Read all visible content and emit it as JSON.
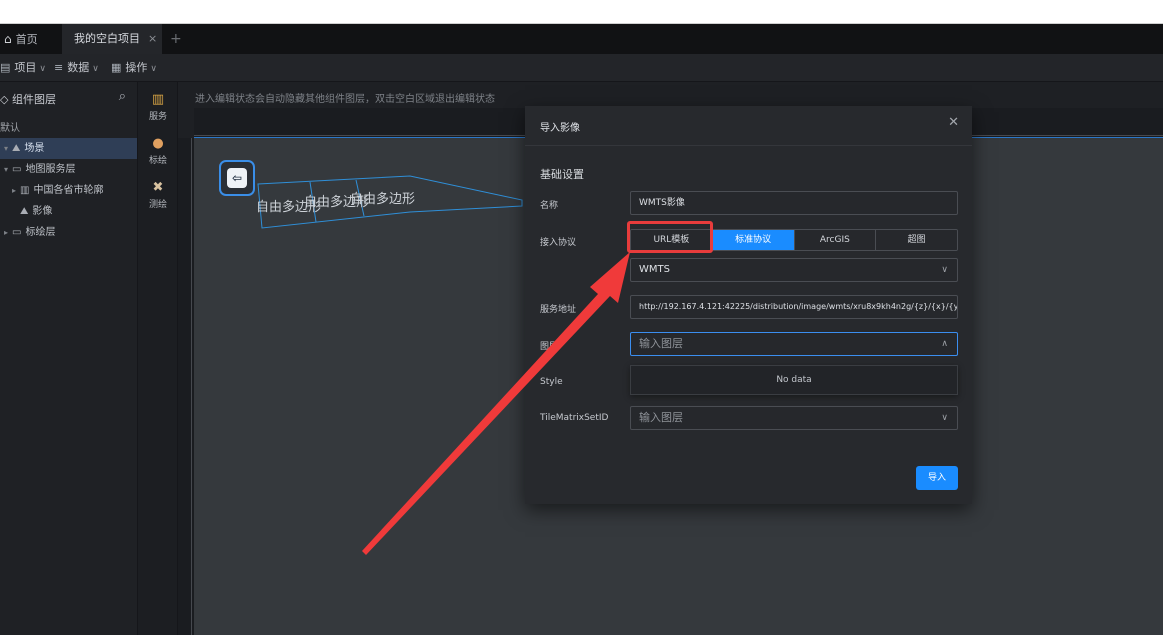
{
  "tabs": {
    "home_label": "首页",
    "project_label": "我的空白项目",
    "close_glyph": "×",
    "add_glyph": "+"
  },
  "toolbar": {
    "project_label": "项目",
    "data_label": "数据",
    "operate_label": "操作"
  },
  "left_panel": {
    "title": "组件图层",
    "default_label": "默认",
    "tree": [
      {
        "label": "场景"
      },
      {
        "label": "地图服务层"
      },
      {
        "label": "中国各省市轮廓"
      },
      {
        "label": "影像"
      },
      {
        "label": "标绘层"
      }
    ]
  },
  "side_bar": {
    "items": [
      {
        "label": "服务"
      },
      {
        "label": "标绘"
      },
      {
        "label": "测绘"
      }
    ]
  },
  "canvas": {
    "hint": "进入编辑状态会自动隐藏其他组件图层，双击空白区域退出编辑状态",
    "polygon_labels": [
      "自由多边形",
      "自由多边形",
      "自由多边形"
    ]
  },
  "modal": {
    "title": "导入影像",
    "section": "基础设置",
    "name_label": "名称",
    "name_value": "WMTS影像",
    "protocol_label": "接入协议",
    "protocol_options": [
      "URL模板",
      "标准协议",
      "ArcGIS",
      "超图"
    ],
    "protocol_selected": "标准协议",
    "service_type_value": "WMTS",
    "service_url_label": "服务地址",
    "service_url_value": "http://192.167.4.121:42225/distribution/image/wmts/xru8x9kh4n2g/{z}/{x}/{y}",
    "layer_label": "图层",
    "layer_placeholder": "输入图层",
    "style_label": "Style",
    "dropdown_empty": "No data",
    "tms_label": "TileMatrixSetID",
    "tms_placeholder": "输入图层",
    "submit_label": "导入"
  },
  "colors": {
    "accent": "#1a8cff",
    "highlight_box": "#e83c3c",
    "annotation_arrow": "#f03a3a"
  }
}
